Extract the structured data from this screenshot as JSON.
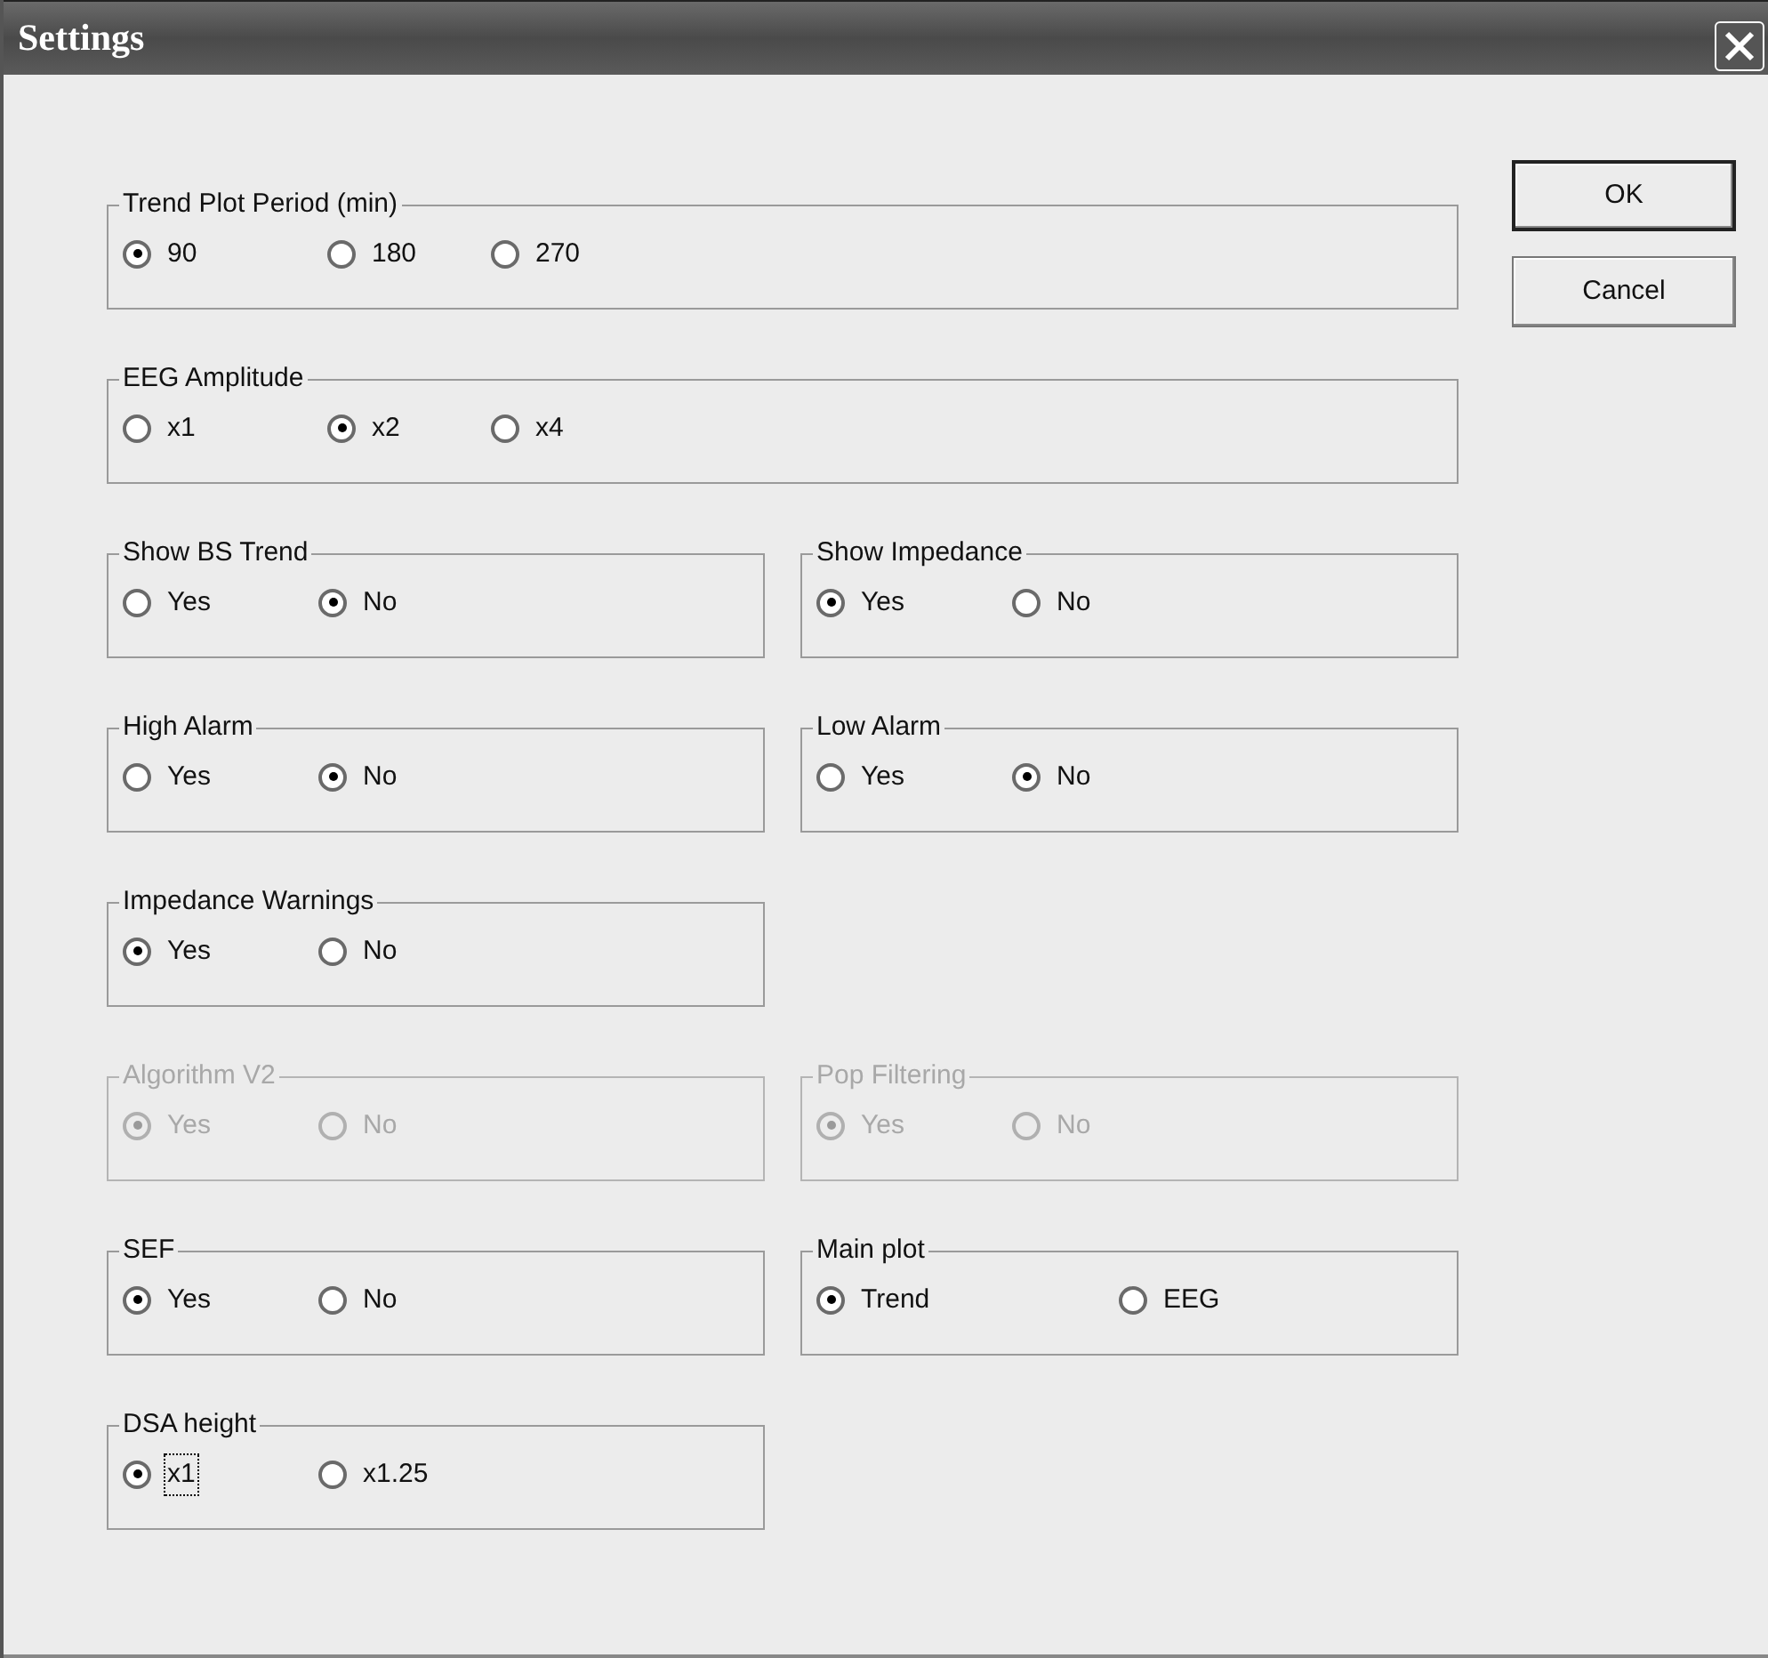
{
  "window": {
    "title": "Settings"
  },
  "groups": [
    {
      "kind": "wide",
      "title": "Trend Plot Period (min)",
      "disabled": false,
      "options": [
        {
          "label": "90",
          "selected": true,
          "focused": false
        },
        {
          "label": "180",
          "selected": false,
          "focused": false
        },
        {
          "label": "270",
          "selected": false,
          "focused": false
        }
      ]
    },
    {
      "kind": "wide",
      "title": "EEG Amplitude",
      "disabled": false,
      "options": [
        {
          "label": "x1",
          "selected": false,
          "focused": false
        },
        {
          "label": "x2",
          "selected": true,
          "focused": false
        },
        {
          "label": "x4",
          "selected": false,
          "focused": false
        }
      ]
    },
    {
      "kind": "left",
      "title": "Show BS Trend",
      "disabled": false,
      "options": [
        {
          "label": "Yes",
          "selected": false,
          "focused": false
        },
        {
          "label": "No",
          "selected": true,
          "focused": false
        }
      ]
    },
    {
      "kind": "right",
      "title": "Show Impedance",
      "disabled": false,
      "options": [
        {
          "label": "Yes",
          "selected": true,
          "focused": false
        },
        {
          "label": "No",
          "selected": false,
          "focused": false
        }
      ]
    },
    {
      "kind": "left",
      "title": "High Alarm",
      "disabled": false,
      "options": [
        {
          "label": "Yes",
          "selected": false,
          "focused": false
        },
        {
          "label": "No",
          "selected": true,
          "focused": false
        }
      ]
    },
    {
      "kind": "right",
      "title": "Low Alarm",
      "disabled": false,
      "options": [
        {
          "label": "Yes",
          "selected": false,
          "focused": false
        },
        {
          "label": "No",
          "selected": true,
          "focused": false
        }
      ]
    },
    {
      "kind": "left",
      "title": "Impedance Warnings",
      "disabled": false,
      "options": [
        {
          "label": "Yes",
          "selected": true,
          "focused": false
        },
        {
          "label": "No",
          "selected": false,
          "focused": false
        }
      ]
    },
    {
      "kind": "empty"
    },
    {
      "kind": "left",
      "title": "Algorithm V2",
      "disabled": true,
      "options": [
        {
          "label": "Yes",
          "selected": true,
          "focused": false
        },
        {
          "label": "No",
          "selected": false,
          "focused": false
        }
      ]
    },
    {
      "kind": "right",
      "title": "Pop Filtering",
      "disabled": true,
      "options": [
        {
          "label": "Yes",
          "selected": true,
          "focused": false
        },
        {
          "label": "No",
          "selected": false,
          "focused": false
        }
      ]
    },
    {
      "kind": "left",
      "title": "SEF",
      "disabled": false,
      "options": [
        {
          "label": "Yes",
          "selected": true,
          "focused": false
        },
        {
          "label": "No",
          "selected": false,
          "focused": false
        }
      ]
    },
    {
      "kind": "right",
      "title": "Main plot",
      "disabled": false,
      "options": [
        {
          "label": "Trend",
          "selected": true,
          "focused": false
        },
        {
          "label": "EEG",
          "selected": false,
          "focused": false
        }
      ]
    },
    {
      "kind": "left",
      "title": "DSA height",
      "disabled": false,
      "options": [
        {
          "label": "x1",
          "selected": true,
          "focused": true
        },
        {
          "label": "x1.25",
          "selected": false,
          "focused": false
        }
      ]
    }
  ],
  "buttons": [
    {
      "label": "OK",
      "default": true
    },
    {
      "label": "Cancel",
      "default": false
    }
  ]
}
